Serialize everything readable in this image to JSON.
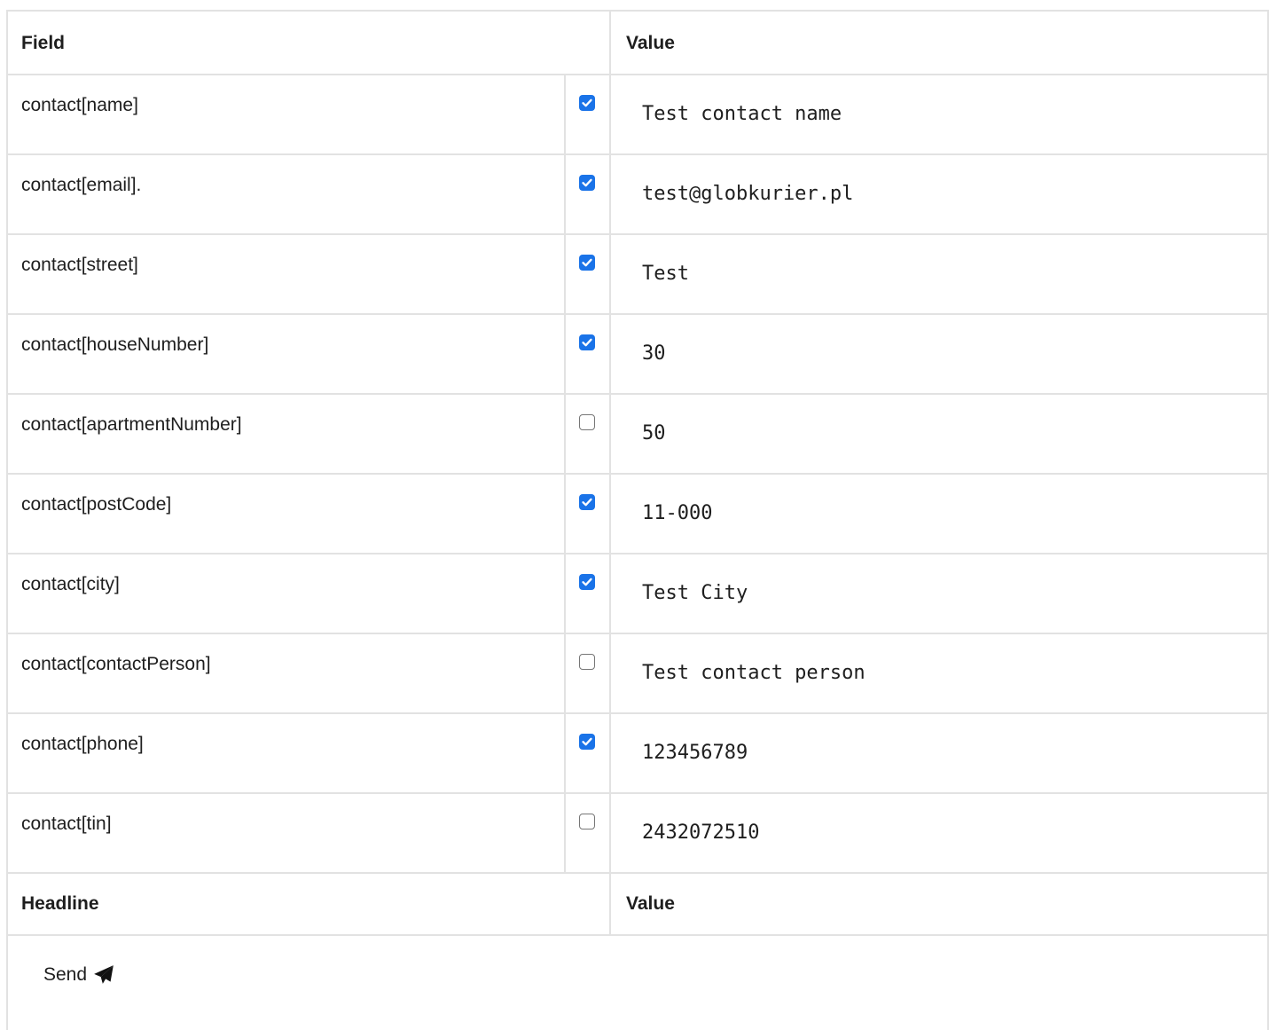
{
  "table": {
    "header": {
      "field": "Field",
      "value": "Value"
    },
    "rows": [
      {
        "field": "contact[name]",
        "checked": true,
        "value": "Test contact name"
      },
      {
        "field": "contact[email].",
        "checked": true,
        "value": "test@globkurier.pl"
      },
      {
        "field": "contact[street]",
        "checked": true,
        "value": "Test"
      },
      {
        "field": "contact[houseNumber]",
        "checked": true,
        "value": "30"
      },
      {
        "field": "contact[apartmentNumber]",
        "checked": false,
        "value": "50"
      },
      {
        "field": "contact[postCode]",
        "checked": true,
        "value": "11-000"
      },
      {
        "field": "contact[city]",
        "checked": true,
        "value": "Test City"
      },
      {
        "field": "contact[contactPerson]",
        "checked": false,
        "value": "Test contact person"
      },
      {
        "field": "contact[phone]",
        "checked": true,
        "value": "123456789"
      },
      {
        "field": "contact[tin]",
        "checked": false,
        "value": "2432072510"
      }
    ],
    "footer_header": {
      "headline": "Headline",
      "value": "Value"
    }
  },
  "send_button": {
    "label": "Send",
    "icon": "paper-plane-icon"
  },
  "colors": {
    "checkbox_on": "#1a73e8",
    "border": "#e2e2e2"
  }
}
